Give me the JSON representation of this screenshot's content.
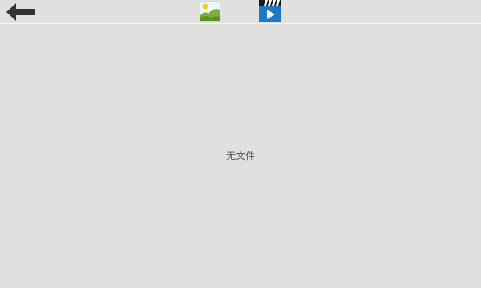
{
  "toolbar": {
    "back_icon": "back-arrow-icon",
    "tabs": [
      {
        "id": "images",
        "icon": "image-gallery-icon"
      },
      {
        "id": "videos",
        "icon": "video-clapperboard-icon"
      }
    ]
  },
  "content": {
    "empty_text": "无文件"
  },
  "colors": {
    "background": "#e1e0df",
    "divider": "#f7f7f7",
    "back_arrow": "#333333",
    "video_icon_blue": "#1e78c8",
    "image_icon_green": "#7cae3a",
    "image_icon_sun": "#f0d020",
    "empty_text": "#555555"
  }
}
